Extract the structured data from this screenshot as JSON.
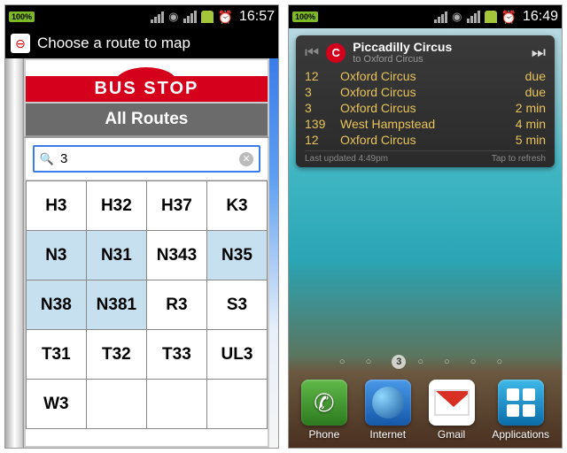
{
  "phone1": {
    "status": {
      "battery": "100%",
      "time": "16:57"
    },
    "app_title": "Choose a route to map",
    "bus_stop_label": "BUS STOP",
    "all_routes_label": "All Routes",
    "search": {
      "value": "3",
      "placeholder": ""
    },
    "routes": [
      [
        {
          "t": "H3"
        },
        {
          "t": "H32"
        },
        {
          "t": "H37"
        },
        {
          "t": "K3"
        }
      ],
      [
        {
          "t": "N3",
          "hl": true
        },
        {
          "t": "N31",
          "hl": true
        },
        {
          "t": "N343"
        },
        {
          "t": "N35",
          "hl": true
        }
      ],
      [
        {
          "t": "N38",
          "hl": true
        },
        {
          "t": "N381",
          "hl": true
        },
        {
          "t": "R3"
        },
        {
          "t": "S3"
        }
      ],
      [
        {
          "t": "T31"
        },
        {
          "t": "T32"
        },
        {
          "t": "T33"
        },
        {
          "t": "UL3"
        }
      ],
      [
        {
          "t": "W3"
        },
        {
          "t": ""
        },
        {
          "t": ""
        },
        {
          "t": ""
        }
      ]
    ]
  },
  "phone2": {
    "status": {
      "battery": "100%",
      "time": "16:49"
    },
    "widget": {
      "line": "C",
      "stop_name": "Piccadilly Circus",
      "stop_dest": "to Oxford Circus",
      "departures": [
        {
          "route": "12",
          "dest": "Oxford Circus",
          "time": "due"
        },
        {
          "route": "3",
          "dest": "Oxford Circus",
          "time": "due"
        },
        {
          "route": "3",
          "dest": "Oxford Circus",
          "time": "2 min"
        },
        {
          "route": "139",
          "dest": "West Hampstead",
          "time": "4 min"
        },
        {
          "route": "12",
          "dest": "Oxford Circus",
          "time": "5 min"
        }
      ],
      "last_updated": "Last updated 4:49pm",
      "tap_refresh": "Tap to refresh"
    },
    "pager": {
      "active": "3"
    },
    "dock": {
      "phone": "Phone",
      "internet": "Internet",
      "gmail": "Gmail",
      "applications": "Applications"
    }
  }
}
